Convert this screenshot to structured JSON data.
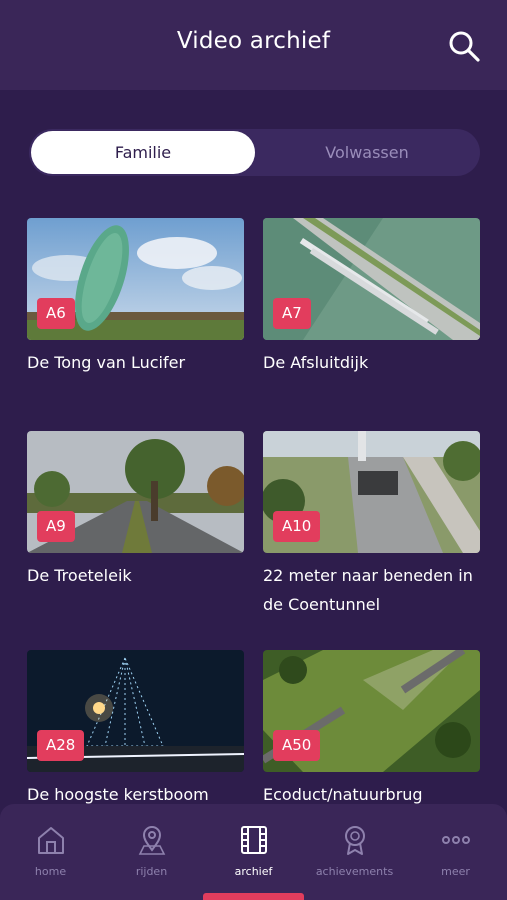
{
  "header": {
    "title": "Video archief"
  },
  "segments": {
    "active": "Familie",
    "inactive": "Volwassen"
  },
  "videos": [
    {
      "badge": "A6",
      "title": "De Tong van Lucifer"
    },
    {
      "badge": "A7",
      "title": "De Afsluitdijk"
    },
    {
      "badge": "A9",
      "title": "De Troeteleik"
    },
    {
      "badge": "A10",
      "title": "22 meter naar beneden in de Coentunnel"
    },
    {
      "badge": "A28",
      "title": "De hoogste kerstboom"
    },
    {
      "badge": "A50",
      "title": "Ecoduct/natuurbrug"
    }
  ],
  "tabs": [
    {
      "label": "home",
      "icon": "home-icon"
    },
    {
      "label": "rijden",
      "icon": "map-pin-icon"
    },
    {
      "label": "archief",
      "icon": "film-icon",
      "active": true
    },
    {
      "label": "achievements",
      "icon": "medal-icon"
    },
    {
      "label": "meer",
      "icon": "more-dots-icon"
    }
  ],
  "colors": {
    "background": "#2e1d4c",
    "header": "#3a2658",
    "accent": "#e23d5d",
    "muted": "#8e81ad"
  }
}
